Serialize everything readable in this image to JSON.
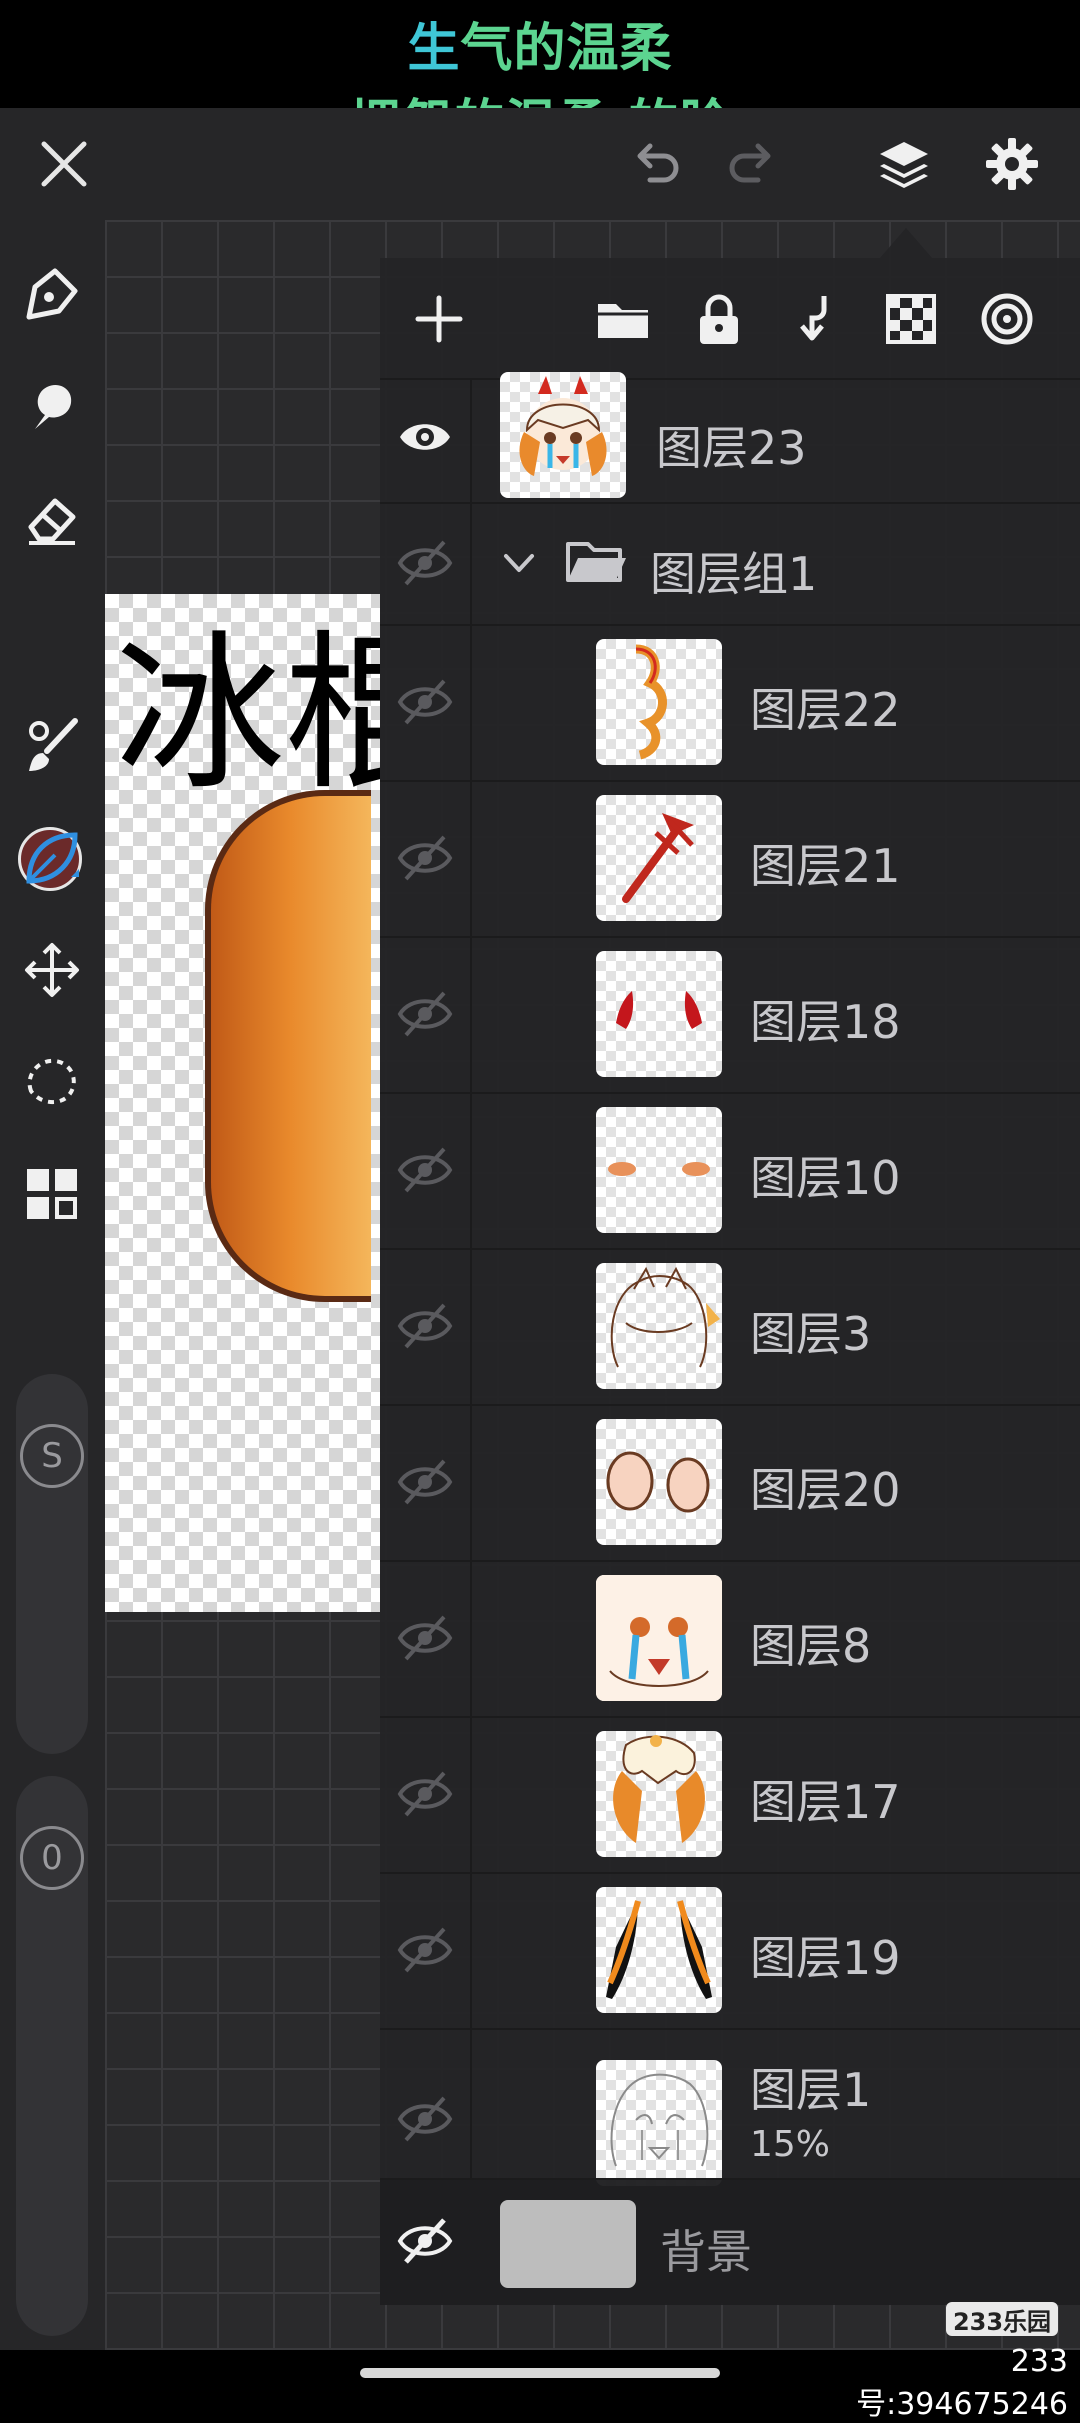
{
  "caption": {
    "line1_part1": "生",
    "line1_part2": "气的温柔",
    "line2": "埋怨的温柔 的脸"
  },
  "canvas": {
    "art_text": "冰棍"
  },
  "toolbar": {
    "color_swatch": "#6b2a2a",
    "active_tool": "select-lasso",
    "size_knob_label": "S",
    "opacity_knob_label": "0"
  },
  "layers": {
    "top_layer": "图层23",
    "group_name": "图层组1",
    "items": [
      {
        "name": "图层22"
      },
      {
        "name": "图层21"
      },
      {
        "name": "图层18"
      },
      {
        "name": "图层10"
      },
      {
        "name": "图层3"
      },
      {
        "name": "图层20"
      },
      {
        "name": "图层8"
      },
      {
        "name": "图层17"
      },
      {
        "name": "图层19"
      },
      {
        "name": "图层1",
        "opacity": "15%"
      }
    ],
    "background_label": "背景"
  },
  "watermark": {
    "logo": "233乐园",
    "id_text": "233号:394675246"
  },
  "colors": {
    "accent_blue": "#2f8fe0",
    "panel_bg": "#242426",
    "caption_cyan": "#3fc6d6",
    "caption_green": "#5cd490"
  }
}
